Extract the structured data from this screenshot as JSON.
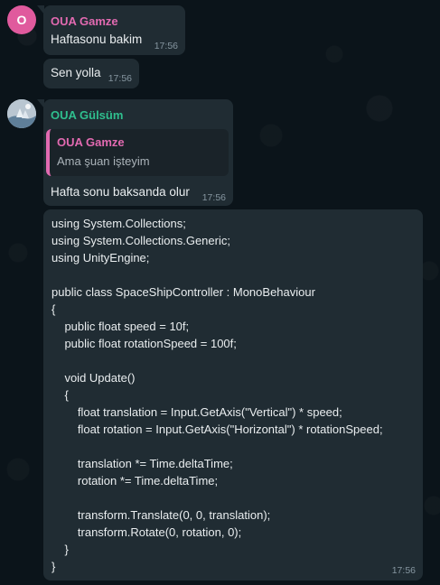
{
  "messages": [
    {
      "sender": "OUA Gamze",
      "avatar_letter": "O",
      "avatar_color": "#e05a9d",
      "name_color": "#e26ab1",
      "text": "Haftasonu bakim",
      "time": "17:56"
    },
    {
      "text": "Sen yolla",
      "time": "17:56"
    },
    {
      "sender": "OUA Gülsüm",
      "name_color": "#2fbf8e",
      "quote": {
        "sender": "OUA Gamze",
        "text": "Ama şuan işteyim"
      },
      "text": "Hafta sonu baksanda olur",
      "time": "17:56"
    },
    {
      "code_lines": [
        "using System.Collections;",
        "using System.Collections.Generic;",
        "using UnityEngine;",
        "",
        "public class SpaceShipController : MonoBehaviour",
        "{",
        "    public float speed = 10f;",
        "    public float rotationSpeed = 100f;",
        "",
        "    void Update()",
        "    {",
        "        float translation = Input.GetAxis(\"Vertical\") * speed;",
        "        float rotation = Input.GetAxis(\"Horizontal\") * rotationSpeed;",
        "",
        "        translation *= Time.deltaTime;",
        "        rotation *= Time.deltaTime;",
        "",
        "        transform.Translate(0, 0, translation);",
        "        transform.Rotate(0, rotation, 0);",
        "    }",
        "}"
      ],
      "time": "17:56"
    }
  ],
  "colors": {
    "background": "#0b141a",
    "bubble": "#202c33",
    "quote_bg": "#1a2329",
    "timestamp": "#8696a0"
  }
}
